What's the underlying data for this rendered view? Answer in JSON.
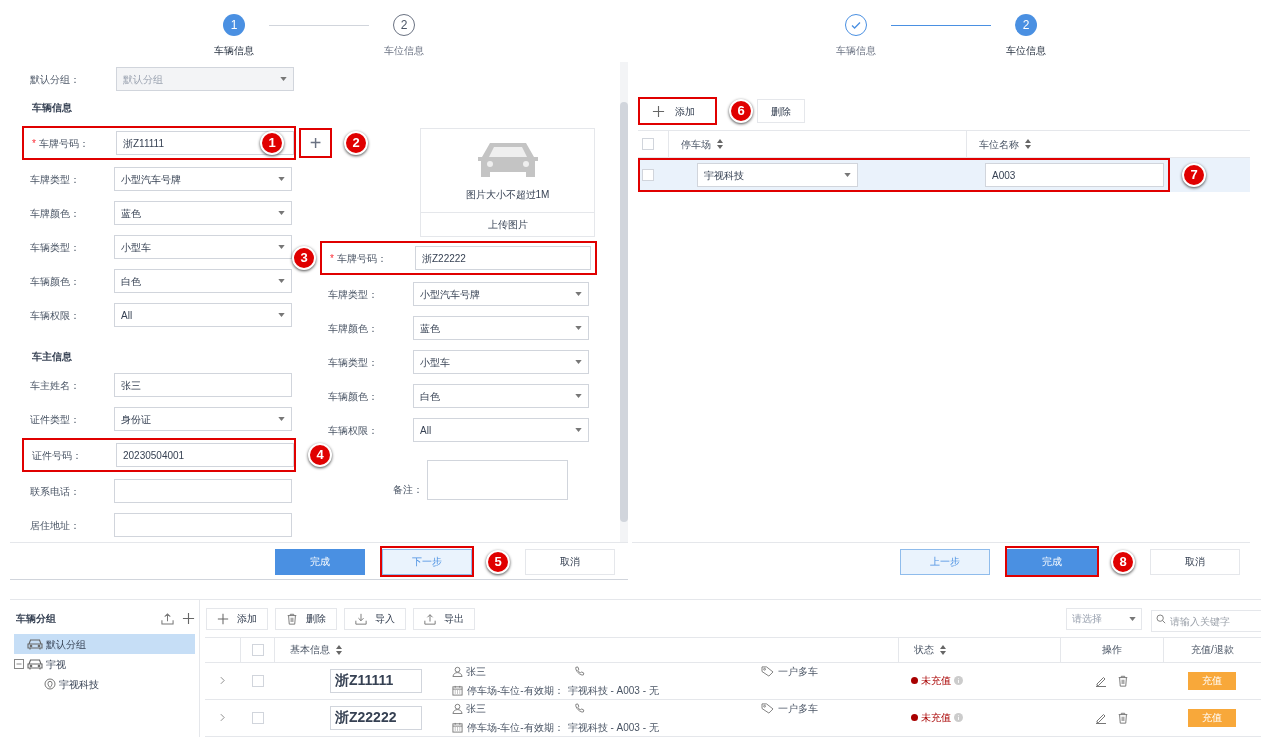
{
  "vehicle_dialog": {
    "steps": [
      {
        "number": "1",
        "label": "车辆信息",
        "selected": true,
        "completed": false
      },
      {
        "number": "2",
        "label": "车位信息",
        "selected": false,
        "completed": false
      }
    ],
    "group_field": {
      "label": "默认分组：",
      "value": "默认分组",
      "kind": "select",
      "disabled": true
    },
    "vehicle_section_title": "车辆信息",
    "vehicle_fields": [
      {
        "label": "车牌号码：",
        "required_mark": "*",
        "value": "浙Z11111",
        "kind": "input",
        "callout": {
          "number": "1"
        }
      },
      {
        "label": "车牌类型：",
        "value": "小型汽车号牌",
        "kind": "select"
      },
      {
        "label": "车牌颜色：",
        "value": "蓝色",
        "kind": "select"
      },
      {
        "label": "车辆类型：",
        "value": "小型车",
        "kind": "select"
      },
      {
        "label": "车辆颜色：",
        "value": "白色",
        "kind": "select"
      },
      {
        "label": "车辆权限：",
        "value": "All",
        "kind": "select"
      }
    ],
    "add_plate_button": {
      "label": "+",
      "callout": {
        "number": "2"
      }
    },
    "owner_section_title": "车主信息",
    "owner_fields": [
      {
        "label": "车主姓名：",
        "value": "张三",
        "kind": "input"
      },
      {
        "label": "证件类型：",
        "value": "身份证",
        "kind": "select"
      },
      {
        "label": "证件号码：",
        "value": "20230504001",
        "kind": "input",
        "callout": {
          "number": "4"
        }
      },
      {
        "label": "联系电话：",
        "kind": "input"
      },
      {
        "label": "居住地址：",
        "kind": "input"
      }
    ],
    "image_upload": {
      "hint": "图片大小不超过1M",
      "button": "上传图片"
    },
    "second_vehicle_fields": [
      {
        "label": "车牌号码：",
        "required_mark": "*",
        "value": "浙Z22222",
        "kind": "input",
        "callout": {
          "number": "3"
        }
      },
      {
        "label": "车牌类型：",
        "value": "小型汽车号牌",
        "kind": "select"
      },
      {
        "label": "车牌颜色：",
        "value": "蓝色",
        "kind": "select"
      },
      {
        "label": "车辆类型：",
        "value": "小型车",
        "kind": "select"
      },
      {
        "label": "车辆颜色：",
        "value": "白色",
        "kind": "select"
      },
      {
        "label": "车辆权限：",
        "value": "All",
        "kind": "select"
      }
    ],
    "remark_label": "备注：",
    "buttons": [
      {
        "label": "完成",
        "kind": "primary"
      },
      {
        "label": "下一步",
        "kind": "secondary",
        "callout": {
          "number": "5"
        }
      },
      {
        "label": "取消",
        "kind": "default"
      }
    ]
  },
  "space_dialog": {
    "steps": [
      {
        "label": "车辆信息",
        "selected": false,
        "completed": true
      },
      {
        "number": "2",
        "label": "车位信息",
        "selected": true,
        "completed": false
      }
    ],
    "toolbar": [
      {
        "label": "添加",
        "kind": "add",
        "callout": {
          "number": "6"
        }
      },
      {
        "label": "删除",
        "kind": "delete"
      }
    ],
    "select_all_checked": false,
    "columns": [
      "停车场",
      "车位名称"
    ],
    "rows": [
      {
        "checked": false,
        "parking_lot": "宇视科技",
        "space_name": "A003",
        "callout": {
          "number": "7"
        }
      }
    ],
    "buttons": [
      {
        "label": "上一步",
        "kind": "secondary"
      },
      {
        "label": "完成",
        "kind": "primary",
        "callout": {
          "number": "8"
        }
      },
      {
        "label": "取消",
        "kind": "default"
      }
    ]
  },
  "vehicle_list": {
    "sidebar": {
      "title": "车辆分组",
      "tree": [
        {
          "label": "默认分组",
          "kind": "group",
          "selected": true
        },
        {
          "label": "宇视",
          "kind": "group",
          "selected": false,
          "expanded": true,
          "children": [
            {
              "label": "宇视科技",
              "kind": "lot",
              "selected": false
            }
          ]
        }
      ]
    },
    "toolbar": [
      {
        "label": "添加",
        "kind": "add"
      },
      {
        "label": "删除",
        "kind": "delete"
      },
      {
        "label": "导入",
        "kind": "import"
      },
      {
        "label": "导出",
        "kind": "export"
      }
    ],
    "filter": {
      "placeholder": "请选择"
    },
    "search": {
      "placeholder": "请输入关键字"
    },
    "select_all_checked": false,
    "columns": [
      "基本信息",
      "状态",
      "操作",
      "充值/退款"
    ],
    "rows": [
      {
        "checked": false,
        "plate": "浙Z11111",
        "owner": "张三",
        "detail_label": "停车场-车位-有效期：",
        "detail_value": "宇视科技 - A003 - 无",
        "tag": "一户多车",
        "status": "未充值",
        "color": "#a80000",
        "action": "充值"
      },
      {
        "checked": false,
        "plate": "浙Z22222",
        "owner": "张三",
        "detail_label": "停车场-车位-有效期：",
        "detail_value": "宇视科技 - A003 - 无",
        "tag": "一户多车",
        "status": "未充值",
        "color": "#a80000",
        "action": "充值"
      }
    ]
  }
}
